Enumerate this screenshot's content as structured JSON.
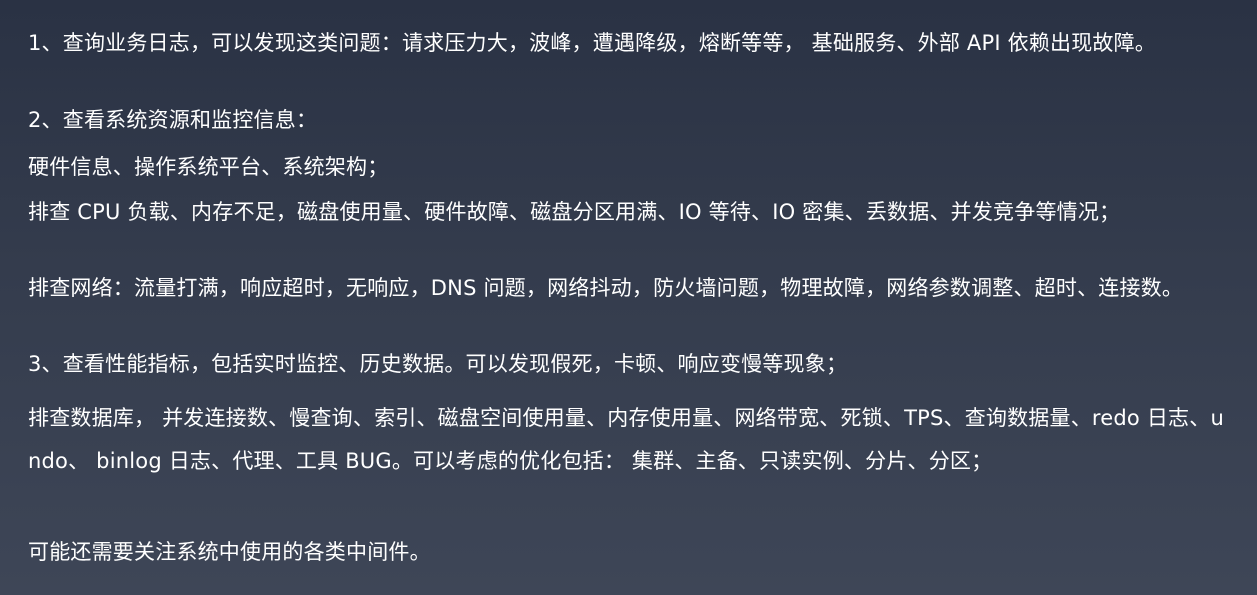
{
  "paragraphs": [
    "1、查询业务日志，可以发现这类问题：请求压力大，波峰，遭遇降级，熔断等等， 基础服务、外部 API 依赖出现故障。",
    "2、查看系统资源和监控信息：",
    "硬件信息、操作系统平台、系统架构；",
    "排查 CPU 负载、内存不足，磁盘使用量、硬件故障、磁盘分区用满、IO 等待、IO 密集、丢数据、并发竞争等情况；",
    "排查网络：流量打满，响应超时，无响应，DNS 问题，网络抖动，防火墙问题，物理故障，网络参数调整、超时、连接数。",
    "3、查看性能指标，包括实时监控、历史数据。可以发现假死，卡顿、响应变慢等现象；",
    "排查数据库， 并发连接数、慢查询、索引、磁盘空间使用量、内存使用量、网络带宽、死锁、TPS、查询数据量、redo 日志、undo、 binlog 日志、代理、工具 BUG。可以考虑的优化包括： 集群、主备、只读实例、分片、分区；",
    "可能还需要关注系统中使用的各类中间件。"
  ]
}
